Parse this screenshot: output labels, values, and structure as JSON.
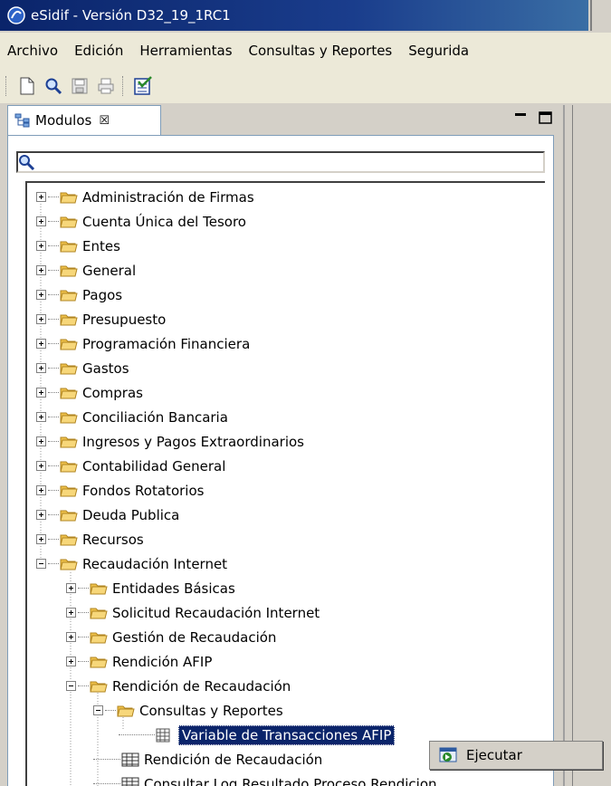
{
  "window": {
    "title": "eSidif - Versión D32_19_1RC1"
  },
  "menu": [
    "Archivo",
    "Edición",
    "Herramientas",
    "Consultas y Reportes",
    "Segurida"
  ],
  "toolbar": {
    "icons": [
      "new-document-icon",
      "search-icon",
      "save-icon",
      "print-icon",
      "checklist-icon"
    ]
  },
  "view": {
    "tab_label": "Modulos",
    "close_glyph": "☒"
  },
  "search": {
    "value": ""
  },
  "tree": {
    "top_level": [
      "Administración de Firmas",
      "Cuenta Única del Tesoro",
      "Entes",
      "General",
      "Pagos",
      "Presupuesto",
      "Programación Financiera",
      "Gastos",
      "Compras",
      "Conciliación Bancaria",
      "Ingresos y Pagos Extraordinarios",
      "Contabilidad General",
      "Fondos Rotatorios",
      "Deuda Publica",
      "Recursos"
    ],
    "expanded": "Recaudación Internet",
    "level2": [
      "Entidades Básicas",
      "Solicitud Recaudación Internet",
      "Gestión de Recaudación",
      "Rendición AFIP"
    ],
    "level2_expanded": "Rendición de Recaudación",
    "level3_folder": "Consultas y Reportes",
    "level4_selected": "Variable de Transacciones AFIP",
    "level3_items": [
      "Rendición de Recaudación",
      "Consultar Log Resultado Proceso Rendicion"
    ]
  },
  "context_menu": {
    "item": "Ejecutar"
  },
  "colors": {
    "selection": "#0a246a",
    "folder": "#f0c24a",
    "titlebar": "#0a246a"
  }
}
